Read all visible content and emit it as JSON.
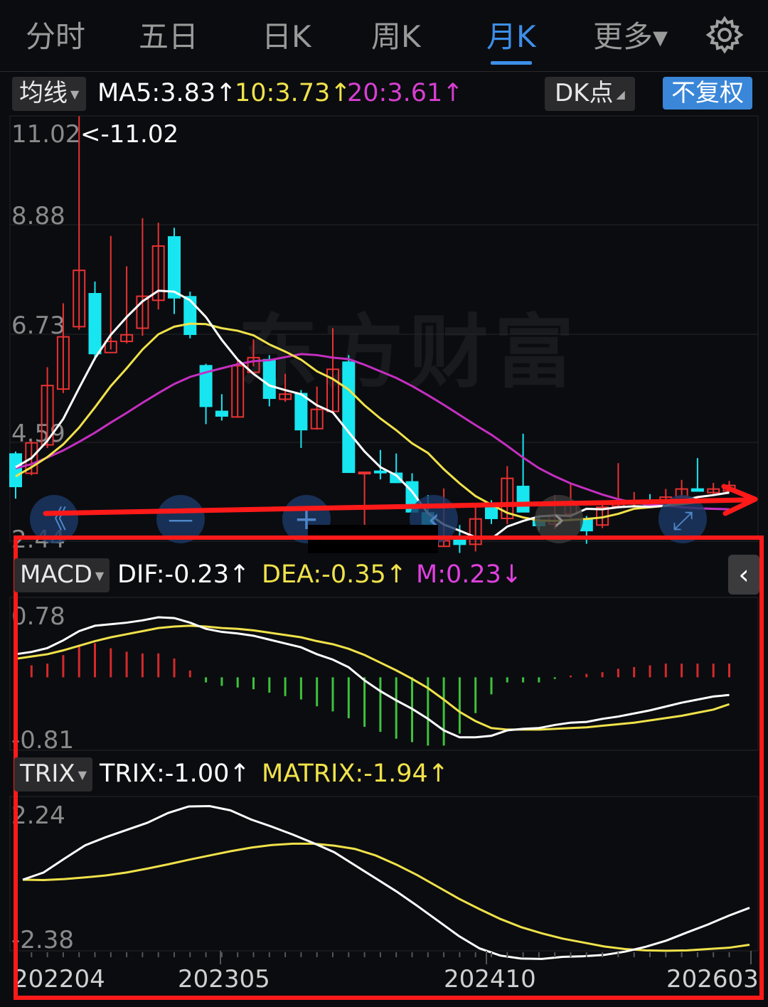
{
  "tabs": [
    {
      "label": "分时"
    },
    {
      "label": "五日"
    },
    {
      "label": "日K"
    },
    {
      "label": "周K"
    },
    {
      "label": "月K"
    },
    {
      "label": "更多▾"
    }
  ],
  "toolbar": {
    "ma_select": "均线",
    "ma5": "MA5:3.83↑",
    "ma10": "10:3.73↑",
    "ma20": "20:3.61↑",
    "dk_button": "DK点",
    "adjust_button": "不复权"
  },
  "watermark": "东方财富",
  "kline": {
    "max_label": "<-11.02",
    "y_ticks": [
      "11.02",
      "8.88",
      "6.73",
      "4.59",
      "2.44"
    ],
    "candles": [
      [
        4.36,
        3.72,
        4.41,
        3.48
      ],
      [
        3.98,
        4.58,
        4.62,
        3.94
      ],
      [
        4.54,
        5.71,
        6.07,
        4.48
      ],
      [
        5.64,
        6.67,
        7.33,
        5.56
      ],
      [
        6.87,
        7.98,
        11.02,
        6.81
      ],
      [
        7.52,
        6.34,
        7.76,
        6.21
      ],
      [
        6.36,
        6.58,
        8.66,
        6.42
      ],
      [
        6.58,
        6.71,
        8.06,
        6.54
      ],
      [
        6.84,
        7.47,
        9.01,
        6.69
      ],
      [
        7.39,
        8.46,
        8.92,
        7.21
      ],
      [
        8.64,
        7.44,
        8.82,
        7.12
      ],
      [
        7.46,
        6.72,
        7.56,
        6.64
      ],
      [
        6.1,
        5.3,
        6.14,
        4.95
      ],
      [
        5.2,
        5.11,
        5.54,
        5.02
      ],
      [
        5.09,
        6.1,
        6.23,
        5.08
      ],
      [
        5.97,
        6.26,
        6.62,
        6.09
      ],
      [
        6.22,
        5.46,
        6.31,
        5.3
      ],
      [
        5.44,
        5.54,
        5.94,
        5.39
      ],
      [
        5.55,
        4.84,
        5.62,
        4.48
      ],
      [
        4.86,
        5.24,
        5.69,
        4.84
      ],
      [
        5.2,
        6.03,
        6.84,
        5.16
      ],
      [
        6.17,
        4.0,
        6.31,
        4.0
      ],
      [
        4.0,
        4.0,
        4.0,
        2.75
      ],
      [
        4.02,
        4.0,
        4.44,
        3.86
      ],
      [
        3.98,
        3.8,
        4.37,
        3.79
      ],
      [
        3.81,
        3.22,
        3.98,
        3.29
      ],
      [
        3.2,
        2.48,
        3.55,
        2.46
      ],
      [
        2.54,
        2.65,
        3.68,
        2.55
      ],
      [
        2.72,
        2.58,
        2.96,
        2.41
      ],
      [
        2.58,
        3.08,
        3.35,
        2.44
      ],
      [
        3.34,
        3.09,
        3.45,
        2.98
      ],
      [
        3.09,
        3.88,
        4.12,
        2.98
      ],
      [
        3.72,
        3.22,
        4.76,
        3.29
      ],
      [
        3.05,
        2.95,
        3.11,
        2.85
      ],
      [
        2.98,
        3.15,
        3.55,
        2.88
      ],
      [
        3.18,
        3.36,
        3.78,
        3.09
      ],
      [
        3.07,
        2.85,
        3.14,
        2.59
      ],
      [
        2.96,
        3.31,
        3.4,
        2.9
      ],
      [
        3.33,
        3.44,
        4.18,
        3.34
      ],
      [
        3.38,
        3.43,
        3.61,
        3.34
      ],
      [
        3.43,
        3.36,
        3.57,
        3.3
      ],
      [
        3.41,
        3.51,
        3.67,
        3.42
      ],
      [
        3.51,
        3.67,
        3.85,
        3.5
      ],
      [
        3.67,
        3.63,
        4.28,
        3.62
      ],
      [
        3.6,
        3.67,
        3.79,
        3.57
      ],
      [
        3.63,
        3.74,
        3.83,
        3.64
      ]
    ],
    "ma5": [
      4.1,
      4.28,
      4.62,
      5.05,
      5.66,
      6.25,
      6.71,
      7.06,
      7.37,
      7.58,
      7.56,
      7.39,
      7.06,
      6.61,
      6.22,
      5.94,
      5.71,
      5.62,
      5.54,
      5.32,
      5.18,
      4.79,
      4.41,
      4.1,
      3.94,
      3.62,
      3.19,
      2.97,
      2.85,
      2.72,
      2.69,
      2.93,
      3.04,
      3.13,
      3.15,
      3.14,
      3.28,
      3.27,
      3.31,
      3.33,
      3.32,
      3.34,
      3.44,
      3.51,
      3.55,
      3.6
    ],
    "ma10": [
      3.92,
      4.1,
      4.3,
      4.55,
      4.88,
      5.28,
      5.7,
      6.05,
      6.42,
      6.72,
      6.87,
      6.93,
      6.92,
      6.84,
      6.79,
      6.7,
      6.52,
      6.38,
      6.22,
      5.99,
      5.84,
      5.63,
      5.32,
      5.06,
      4.83,
      4.57,
      4.38,
      4.06,
      3.78,
      3.53,
      3.36,
      3.2,
      3.11,
      3.05,
      3.04,
      3.06,
      3.08,
      3.11,
      3.18,
      3.28,
      3.31,
      3.34,
      3.37,
      3.41,
      3.45,
      3.46
    ],
    "ma20": [
      4.08,
      4.16,
      4.29,
      4.43,
      4.6,
      4.78,
      4.98,
      5.17,
      5.37,
      5.56,
      5.74,
      5.88,
      5.97,
      6.05,
      6.13,
      6.19,
      6.21,
      6.27,
      6.33,
      6.31,
      6.26,
      6.23,
      6.12,
      5.99,
      5.86,
      5.7,
      5.52,
      5.33,
      5.13,
      4.93,
      4.74,
      4.52,
      4.29,
      4.08,
      3.92,
      3.78,
      3.67,
      3.56,
      3.47,
      3.4,
      3.36,
      3.34,
      3.31,
      3.29,
      3.28,
      3.27
    ]
  },
  "macd": {
    "select": "MACD",
    "dif": "DIF:-0.23↑",
    "dea": "DEA:-0.35↑",
    "m": "M:0.23↓",
    "y_ticks": [
      "0.78",
      "-0.81"
    ],
    "dif_series": [
      0.3,
      0.33,
      0.38,
      0.48,
      0.6,
      0.67,
      0.69,
      0.71,
      0.74,
      0.78,
      0.77,
      0.71,
      0.63,
      0.59,
      0.57,
      0.54,
      0.49,
      0.44,
      0.39,
      0.3,
      0.23,
      0.13,
      -0.04,
      -0.18,
      -0.3,
      -0.41,
      -0.54,
      -0.69,
      -0.78,
      -0.78,
      -0.76,
      -0.69,
      -0.67,
      -0.66,
      -0.62,
      -0.59,
      -0.58,
      -0.54,
      -0.51,
      -0.47,
      -0.43,
      -0.38,
      -0.33,
      -0.29,
      -0.25,
      -0.23
    ],
    "dea_series": [
      0.24,
      0.27,
      0.3,
      0.35,
      0.41,
      0.47,
      0.52,
      0.56,
      0.6,
      0.64,
      0.66,
      0.67,
      0.66,
      0.64,
      0.63,
      0.61,
      0.58,
      0.55,
      0.52,
      0.47,
      0.43,
      0.37,
      0.29,
      0.19,
      0.09,
      -0.02,
      -0.14,
      -0.29,
      -0.45,
      -0.57,
      -0.66,
      -0.68,
      -0.68,
      -0.68,
      -0.67,
      -0.66,
      -0.65,
      -0.63,
      -0.61,
      -0.59,
      -0.56,
      -0.53,
      -0.5,
      -0.46,
      -0.42,
      -0.35
    ],
    "m_series": [
      0.12,
      0.14,
      0.16,
      0.26,
      0.38,
      0.4,
      0.34,
      0.3,
      0.28,
      0.28,
      0.22,
      0.08,
      -0.06,
      -0.1,
      -0.12,
      -0.14,
      -0.18,
      -0.22,
      -0.26,
      -0.34,
      -0.4,
      -0.48,
      -0.58,
      -0.64,
      -0.72,
      -0.76,
      -0.8,
      -0.8,
      -0.66,
      -0.42,
      -0.2,
      -0.06,
      -0.06,
      -0.06,
      -0.02,
      0.02,
      0.04,
      0.06,
      0.1,
      0.12,
      0.14,
      0.16,
      0.16,
      0.16,
      0.16,
      0.16
    ]
  },
  "trix": {
    "select": "TRIX",
    "trix_label": "TRIX:-1.00↑",
    "matrix_label": "MATRIX:-1.94↑",
    "y_ticks": [
      "2.24",
      "-2.38"
    ],
    "trix_series": [
      0.0,
      0.22,
      0.64,
      1.05,
      1.3,
      1.52,
      1.74,
      2.04,
      2.24,
      2.25,
      2.12,
      1.84,
      1.62,
      1.38,
      1.12,
      0.84,
      0.44,
      0.04,
      -0.36,
      -0.8,
      -1.26,
      -1.72,
      -2.1,
      -2.32,
      -2.41,
      -2.42,
      -2.36,
      -2.34,
      -2.3,
      -2.2,
      -2.05,
      -1.86,
      -1.61,
      -1.37,
      -1.1,
      -0.86
    ],
    "matrix_series": [
      0.0,
      -0.01,
      0.02,
      0.07,
      0.13,
      0.22,
      0.34,
      0.47,
      0.61,
      0.74,
      0.87,
      0.98,
      1.06,
      1.1,
      1.1,
      1.04,
      0.94,
      0.74,
      0.46,
      0.14,
      -0.22,
      -0.58,
      -0.9,
      -1.2,
      -1.45,
      -1.64,
      -1.8,
      -1.92,
      -2.04,
      -2.12,
      -2.16,
      -2.17,
      -2.16,
      -2.12,
      -2.08,
      -1.99
    ]
  },
  "x_labels": [
    "202204",
    "202305",
    "202410",
    "202603"
  ],
  "controls": {
    "collapse": "《",
    "minus": "—",
    "plus": "+",
    "prev": "‹",
    "next": "›",
    "fullscreen": "⤢"
  }
}
